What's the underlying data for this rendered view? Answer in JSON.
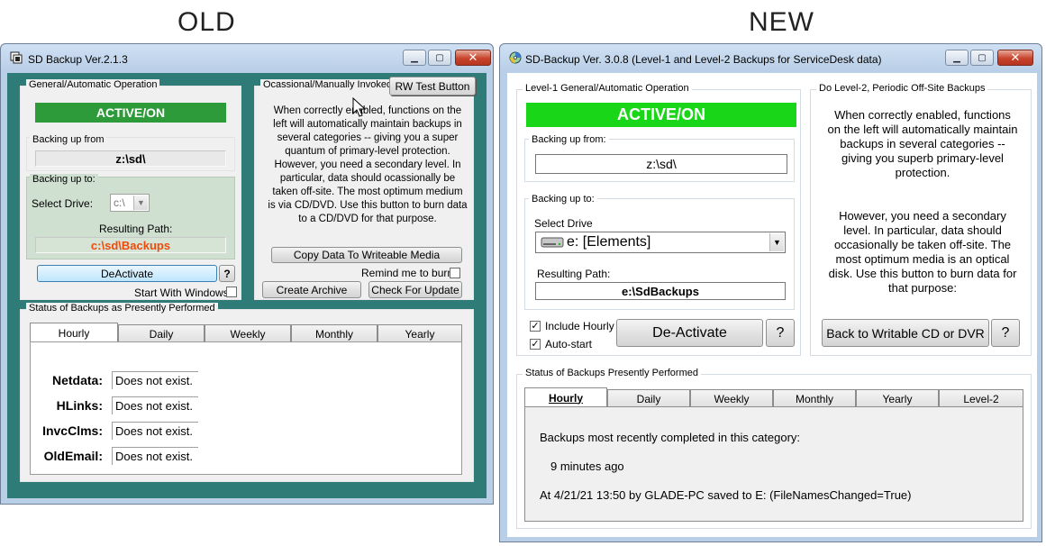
{
  "headings": {
    "old": "OLD",
    "new": "NEW"
  },
  "colors": {
    "active_green": "#2e9b3a",
    "active_green_new": "#19d619",
    "old_client_bg": "#2f7b78",
    "new_client_bg": "#2f7b78",
    "path_orange": "#f04a0a"
  },
  "old_app": {
    "title": "SD Backup Ver.2.1.3",
    "icon": "backup-app-icon",
    "general": {
      "legend": "General/Automatic Operation",
      "status": "ACTIVE/ON",
      "backing_from_label": "Backing up from",
      "backing_from_value": "z:\\sd\\",
      "backing_to_label": "Backing up to:",
      "select_drive_label": "Select Drive:",
      "drive_value": "c:\\",
      "resulting_path_label": "Resulting Path:",
      "resulting_path_value": "c:\\sd\\Backups",
      "deactivate_label": "DeActivate",
      "help_label": "?",
      "start_with_windows_label": "Start With Windows"
    },
    "occasional": {
      "legend": "Ocassional/Manually Invoked",
      "rw_test_label": "RW Test Button",
      "description": "When correctly enabled, functions on the left will automatically maintain backups in several categories -- giving you a super quantum of primary-level protection.  However, you need a secondary level.  In particular, data should ocassionally be taken off-site.  The most optimum medium is via CD/DVD.  Use this button to burn data to a CD/DVD for that purpose.",
      "copy_label": "Copy Data To Writeable Media",
      "remind_label": "Remind me to burn",
      "create_archive_label": "Create Archive",
      "check_update_label": "Check For Update"
    },
    "status": {
      "legend": "Status of Backups as Presently Performed",
      "tabs": [
        "Hourly",
        "Daily",
        "Weekly",
        "Monthly",
        "Yearly"
      ],
      "rows": [
        {
          "name": "Netdata:",
          "value": "Does not exist."
        },
        {
          "name": "HLinks:",
          "value": "Does not exist."
        },
        {
          "name": "InvcClms:",
          "value": "Does not exist."
        },
        {
          "name": "OldEmail:",
          "value": "Does not exist."
        }
      ]
    }
  },
  "new_app": {
    "title": "SD-Backup Ver. 3.0.8 (Level-1 and Level-2 Backups for ServiceDesk data)",
    "icon": "cd-disc-icon",
    "level1": {
      "legend": "Level-1 General/Automatic Operation",
      "status": "ACTIVE/ON",
      "backing_from_label": "Backing up from:",
      "backing_from_value": "z:\\sd\\",
      "backing_to_label": "Backing up to:",
      "select_drive_label": "Select Drive",
      "drive_value": "e: [Elements]",
      "resulting_path_label": "Resulting Path:",
      "resulting_path_value": "e:\\SdBackups",
      "include_hourly_label": "Include Hourly",
      "auto_start_label": "Auto-start",
      "deactivate_label": "De-Activate",
      "help_label": "?"
    },
    "level2": {
      "legend": "Do Level-2, Periodic Off-Site Backups",
      "description1": "When correctly enabled, functions on the left will automatically maintain backups in several categories -- giving you superb primary-level protection.",
      "description2": "However, you need a secondary level.  In particular, data should occasionally be taken off-site.  The most optimum media is an optical disk.  Use this button to burn data for that purpose:",
      "back_to_label": "Back to Writable CD or DVR",
      "help_label": "?"
    },
    "status": {
      "legend": "Status of Backups Presently Performed",
      "tabs": [
        "Hourly",
        "Daily",
        "Weekly",
        "Monthly",
        "Yearly",
        "Level-2"
      ],
      "line1": "Backups most recently completed in this category:",
      "line2": "9 minutes ago",
      "line3": "At 4/21/21 13:50 by GLADE-PC saved to E:  (FileNamesChanged=True)"
    }
  }
}
